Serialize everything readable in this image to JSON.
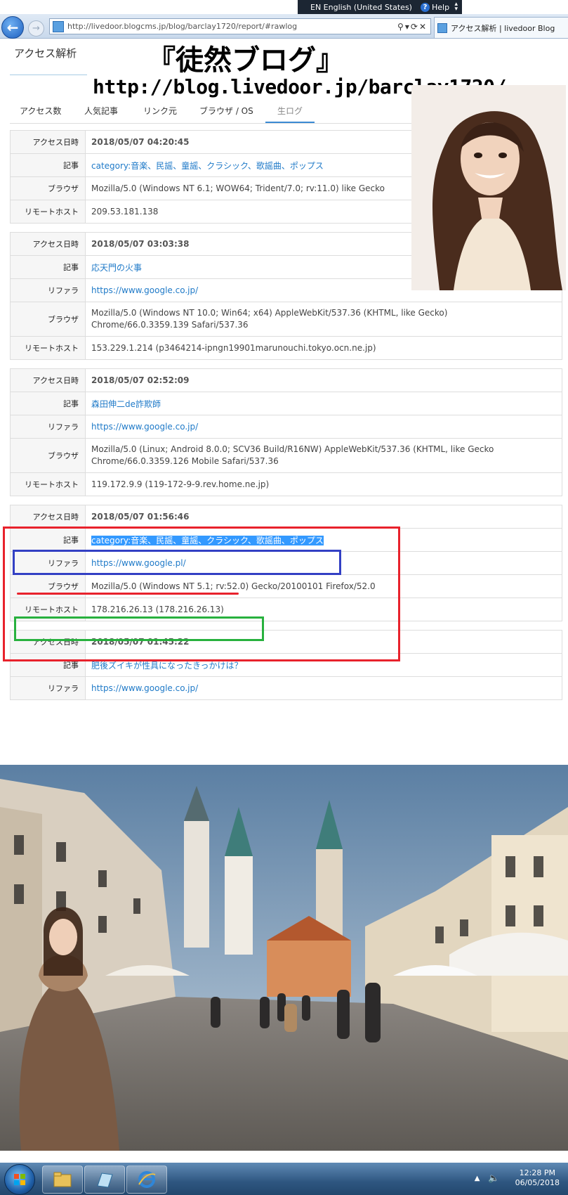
{
  "browser": {
    "language_bar": {
      "label": "EN English (United States)",
      "help": "Help"
    },
    "url": "http://livedoor.blogcms.jp/blog/barclay1720/report/#rawlog",
    "tab_title": "アクセス解析 | livedoor Blog"
  },
  "page": {
    "site_title": "アクセス解析",
    "overlay_title": "『徒然ブログ』",
    "overlay_url": "http://blog.livedoor.jp/barclay1720/",
    "tabs": [
      {
        "label": "アクセス数"
      },
      {
        "label": "人気記事"
      },
      {
        "label": "リンク元"
      },
      {
        "label": "ブラウザ / OS"
      },
      {
        "label": "生ログ",
        "active": true
      }
    ],
    "labels": {
      "access_time": "アクセス日時",
      "article": "記事",
      "referrer": "リファラ",
      "browser": "ブラウザ",
      "remote_host": "リモートホスト"
    },
    "logs": [
      {
        "access_time": "2018/05/07 04:20:45",
        "article": "category:音楽、民謡、童謡、クラシック、歌謡曲、ポップス",
        "browser": "Mozilla/5.0 (Windows NT 6.1; WOW64; Trident/7.0; rv:11.0) like Gecko",
        "remote_host": "209.53.181.138"
      },
      {
        "access_time": "2018/05/07 03:03:38",
        "article": "応天門の火事",
        "referrer": "https://www.google.co.jp/",
        "browser_line1": "Mozilla/5.0 (Windows NT 10.0; Win64; x64) AppleWebKit/537.36 (KHTML, like Gecko)",
        "browser_line2": "Chrome/66.0.3359.139 Safari/537.36",
        "remote_host": "153.229.1.214 (p3464214-ipngn19901marunouchi.tokyo.ocn.ne.jp)"
      },
      {
        "access_time": "2018/05/07 02:52:09",
        "article": "森田伸二de詐欺師",
        "referrer": "https://www.google.co.jp/",
        "browser_line1": "Mozilla/5.0 (Linux; Android 8.0.0; SCV36 Build/R16NW) AppleWebKit/537.36 (KHTML, like Gecko",
        "browser_line2": "Chrome/66.0.3359.126 Mobile Safari/537.36",
        "remote_host": "119.172.9.9 (119-172-9-9.rev.home.ne.jp)"
      },
      {
        "access_time": "2018/05/07 01:56:46",
        "article": "category:音楽、民謡、童謡、クラシック、歌謡曲、ポップス",
        "referrer": "https://www.google.pl/",
        "browser": "Mozilla/5.0 (Windows NT 5.1; rv:52.0) Gecko/20100101 Firefox/52.0",
        "remote_host": "178.216.26.13 (178.216.26.13)"
      },
      {
        "access_time": "2018/05/07 01:45:22",
        "article": "肥後ズイキが性具になったきっかけは？",
        "referrer": "https://www.google.co.jp/"
      }
    ]
  },
  "taskbar": {
    "time": "12:28 PM",
    "date": "06/05/2018"
  },
  "colors": {
    "link": "#1f7ac8",
    "highlight_red": "#e8222c",
    "highlight_blue": "#3340c4",
    "highlight_green": "#28b13e",
    "selection": "#3399ff"
  }
}
